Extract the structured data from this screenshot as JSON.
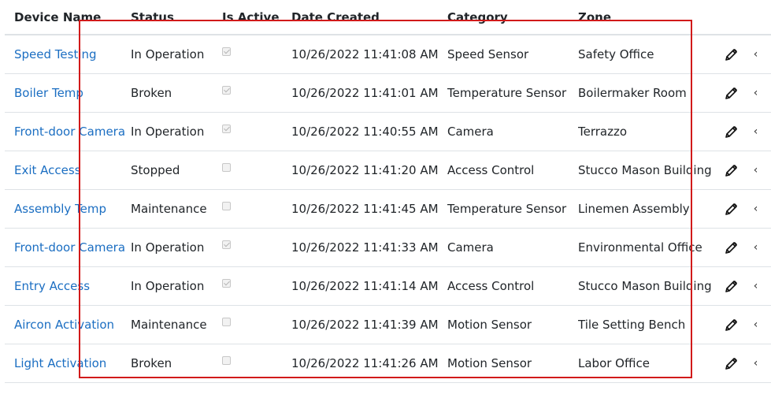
{
  "table": {
    "headers": {
      "device_name": "Device Name",
      "status": "Status",
      "is_active": "Is Active",
      "date_created": "Date Created",
      "category": "Category",
      "zone": "Zone"
    },
    "rows": [
      {
        "name": "Speed Testing",
        "status": "In Operation",
        "active": true,
        "date": "10/26/2022 11:41:08 AM",
        "category": "Speed Sensor",
        "zone": "Safety Office"
      },
      {
        "name": "Boiler Temp",
        "status": "Broken",
        "active": true,
        "date": "10/26/2022 11:41:01 AM",
        "category": "Temperature Sensor",
        "zone": "Boilermaker Room"
      },
      {
        "name": "Front-door Camera",
        "status": "In Operation",
        "active": true,
        "date": "10/26/2022 11:40:55 AM",
        "category": "Camera",
        "zone": "Terrazzo"
      },
      {
        "name": "Exit Access",
        "status": "Stopped",
        "active": false,
        "date": "10/26/2022 11:41:20 AM",
        "category": "Access Control",
        "zone": "Stucco Mason Building"
      },
      {
        "name": "Assembly Temp",
        "status": "Maintenance",
        "active": false,
        "date": "10/26/2022 11:41:45 AM",
        "category": "Temperature Sensor",
        "zone": "Linemen Assembly"
      },
      {
        "name": "Front-door Camera",
        "status": "In Operation",
        "active": true,
        "date": "10/26/2022 11:41:33 AM",
        "category": "Camera",
        "zone": "Environmental Office"
      },
      {
        "name": "Entry Access",
        "status": "In Operation",
        "active": true,
        "date": "10/26/2022 11:41:14 AM",
        "category": "Access Control",
        "zone": "Stucco Mason Building"
      },
      {
        "name": "Aircon Activation",
        "status": "Maintenance",
        "active": false,
        "date": "10/26/2022 11:41:39 AM",
        "category": "Motion Sensor",
        "zone": "Tile Setting Bench"
      },
      {
        "name": "Light Activation",
        "status": "Broken",
        "active": false,
        "date": "10/26/2022 11:41:26 AM",
        "category": "Motion Sensor",
        "zone": "Labor Office"
      }
    ]
  },
  "icons": {
    "edit": "pencil-icon",
    "more": "chevron-left-icon"
  },
  "colors": {
    "link": "#1b6ec2",
    "highlight_border": "#d11a1a"
  }
}
